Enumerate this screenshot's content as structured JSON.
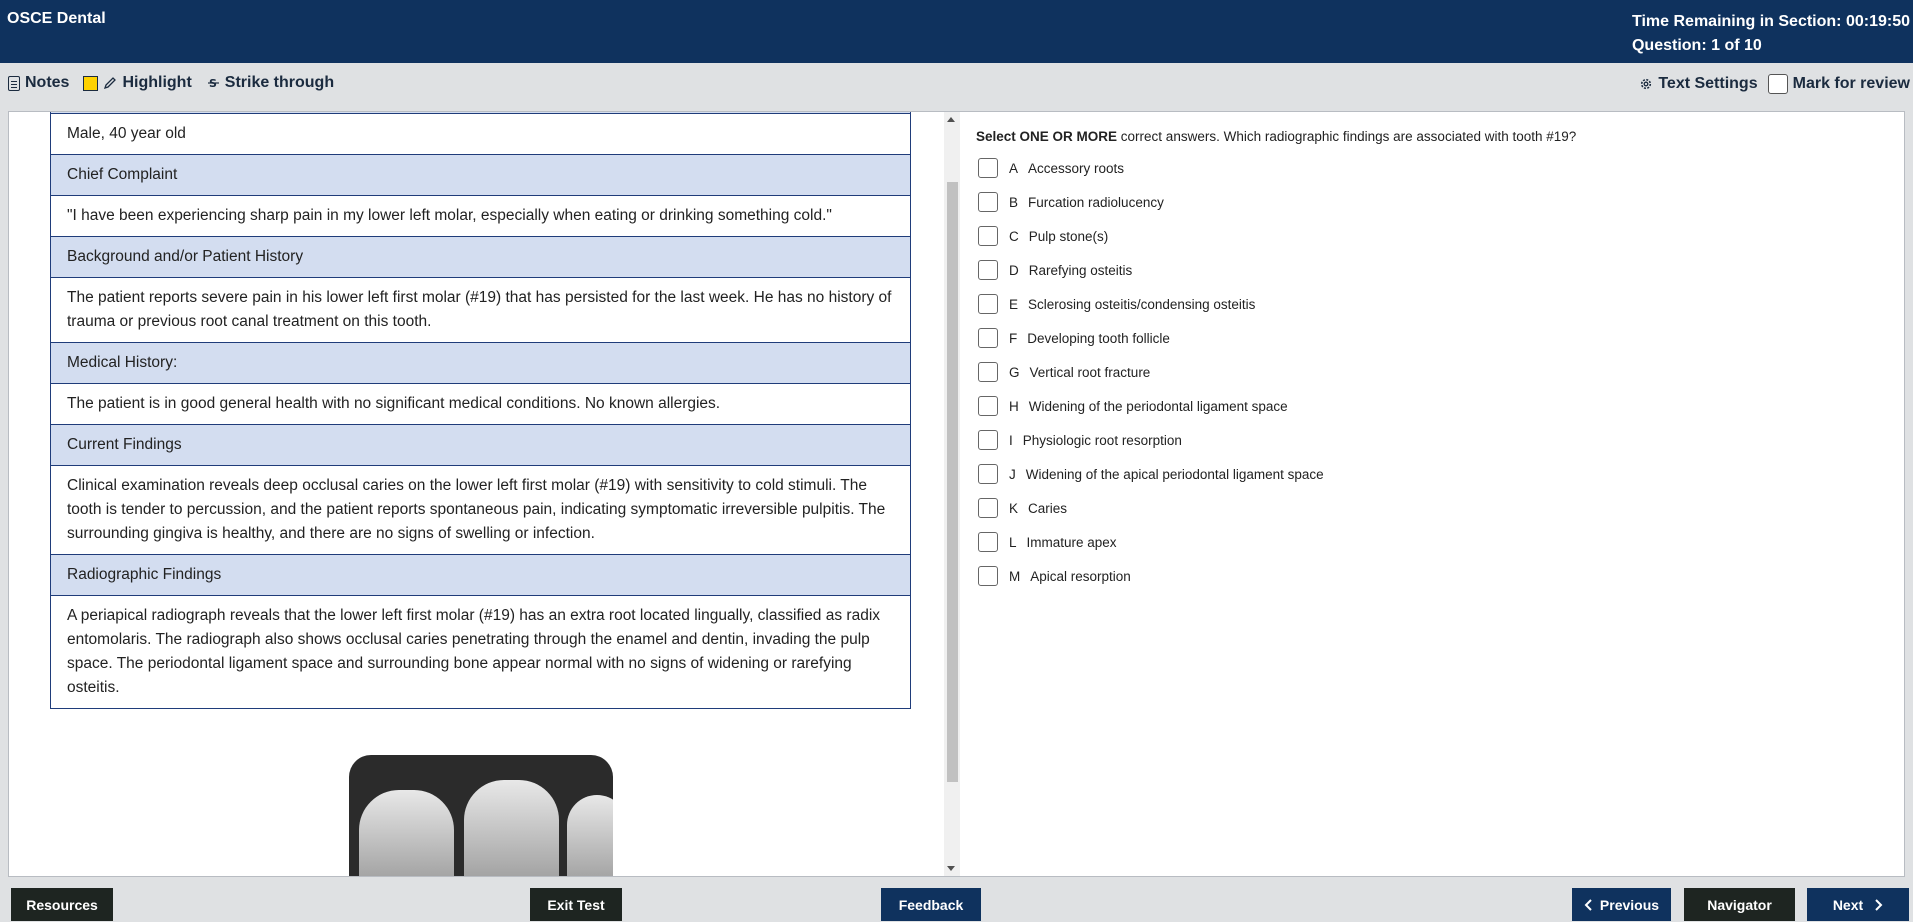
{
  "header": {
    "app_title": "OSCE Dental",
    "time_remaining": "Time Remaining in Section: 00:19:50",
    "question_counter": "Question: 1 of 10"
  },
  "toolbar": {
    "notes": "Notes",
    "highlight": "Highlight",
    "strike": "Strike through",
    "text_settings": "Text Settings",
    "mark_review": "Mark for review"
  },
  "case": [
    {
      "type": "text",
      "text": "Male, 40 year old"
    },
    {
      "type": "header",
      "text": "Chief Complaint"
    },
    {
      "type": "text",
      "text": "\"I have been experiencing sharp pain in my lower left molar, especially when eating or drinking something cold.\""
    },
    {
      "type": "header",
      "text": "Background and/or Patient History"
    },
    {
      "type": "text",
      "text": "The patient reports severe pain in his lower left first molar (#19) that has persisted for the last week. He has no history of trauma or previous root canal treatment on this tooth."
    },
    {
      "type": "header",
      "text": "Medical History:"
    },
    {
      "type": "text",
      "text": "The patient is in good general health with no significant medical conditions. No known allergies."
    },
    {
      "type": "header",
      "text": "Current Findings"
    },
    {
      "type": "text",
      "text": "Clinical examination reveals deep occlusal caries on the lower left first molar (#19) with sensitivity to cold stimuli. The tooth is tender to percussion, and the patient reports spontaneous pain, indicating symptomatic irreversible pulpitis. The surrounding gingiva is healthy, and there are no signs of swelling or infection."
    },
    {
      "type": "header",
      "text": "Radiographic Findings"
    },
    {
      "type": "text",
      "text": "A periapical radiograph reveals that the lower left first molar (#19) has an extra root located lingually, classified as radix entomolaris. The radiograph also shows occlusal caries penetrating through the enamel and dentin, invading the pulp space. The periodontal ligament space and surrounding bone appear normal with no signs of widening or rarefying osteitis."
    }
  ],
  "question": {
    "lead": "Select ONE OR MORE",
    "text": " correct answers. Which radiographic findings are associated with tooth #19?"
  },
  "options": [
    {
      "letter": "A",
      "text": "Accessory roots"
    },
    {
      "letter": "B",
      "text": "Furcation radiolucency"
    },
    {
      "letter": "C",
      "text": "Pulp stone(s)"
    },
    {
      "letter": "D",
      "text": "Rarefying osteitis"
    },
    {
      "letter": "E",
      "text": "Sclerosing osteitis/condensing osteitis"
    },
    {
      "letter": "F",
      "text": "Developing tooth follicle"
    },
    {
      "letter": "G",
      "text": "Vertical root fracture"
    },
    {
      "letter": "H",
      "text": "Widening of the periodontal ligament space"
    },
    {
      "letter": "I",
      "text": "Physiologic root resorption"
    },
    {
      "letter": "J",
      "text": "Widening of the apical periodontal ligament space"
    },
    {
      "letter": "K",
      "text": "Caries"
    },
    {
      "letter": "L",
      "text": "Immature apex"
    },
    {
      "letter": "M",
      "text": "Apical resorption"
    }
  ],
  "footer": {
    "resources": "Resources",
    "exit": "Exit Test",
    "feedback": "Feedback",
    "previous": "Previous",
    "navigator": "Navigator",
    "next": "Next"
  },
  "colors": {
    "header_bg": "#0f325e",
    "table_header_bg": "#d3ddf0",
    "highlight_swatch": "#ffd200",
    "dark_button": "#1e2521"
  }
}
